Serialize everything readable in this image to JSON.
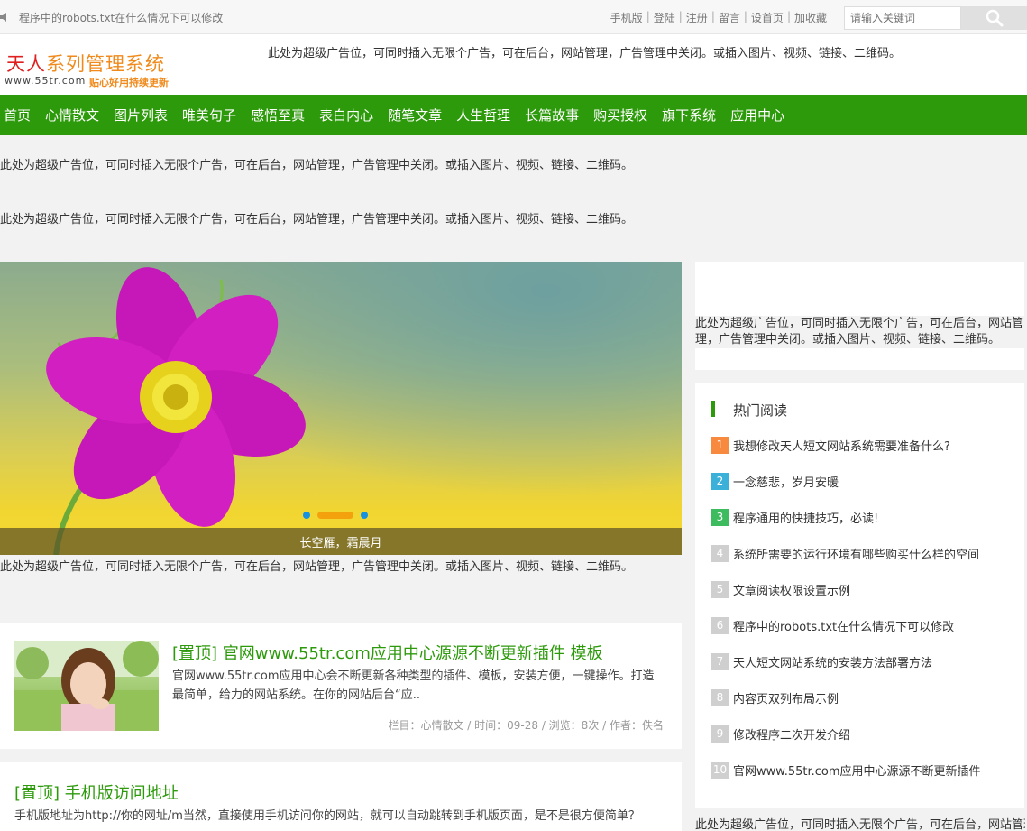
{
  "topbar": {
    "notice": "程序中的robots.txt在什么情况下可以修改",
    "links": [
      "手机版",
      "登陆",
      "注册",
      "留言",
      "设首页",
      "加收藏"
    ],
    "search_placeholder": "请输入关键词"
  },
  "header": {
    "logo_part1": "天人",
    "logo_part2": "系列管理系统",
    "logo_url": "www.55tr.com",
    "logo_tagline": "贴心好用持续更新",
    "ad": "此处为超级广告位，可同时插入无限个广告，可在后台，网站管理，广告管理中关闭。或插入图片、视频、链接、二维码。"
  },
  "nav": [
    "首页",
    "心情散文",
    "图片列表",
    "唯美句子",
    "感悟至真",
    "表白内心",
    "随笔文章",
    "人生哲理",
    "长篇故事",
    "购买授权",
    "旗下系统",
    "应用中心"
  ],
  "ads": {
    "ad1": "此处为超级广告位，可同时插入无限个广告，可在后台，网站管理，广告管理中关闭。或插入图片、视频、链接、二维码。",
    "ad2": "此处为超级广告位，可同时插入无限个广告，可在后台，网站管理，广告管理中关闭。或插入图片、视频、链接、二维码。",
    "ad3": "此处为超级广告位，可同时插入无限个广告，可在后台，网站管理，广告管理中关闭。或插入图片、视频、链接、二维码。"
  },
  "slider": {
    "caption": "长空雁，霜晨月"
  },
  "articles": [
    {
      "title": "[置顶] 官网www.55tr.com应用中心源源不断更新插件 模板",
      "desc": "官网www.55tr.com应用中心会不断更新各种类型的插件、模板，安装方便，一键操作。打造最简单，给力的网站系统。在你的网站后台“应..",
      "meta": "栏目：心情散文 / 时间：09-28 / 浏览：8次 / 作者：佚名"
    },
    {
      "title": "[置顶] 手机版访问地址",
      "desc": "手机版地址为http://你的网址/m当然，直接使用手机访问你的网站，就可以自动跳转到手机版页面，是不是很方便简单？"
    }
  ],
  "sidebar": {
    "ad": "此处为超级广告位，可同时插入无限个广告，可在后台，网站管理，广告管理中关闭。或插入图片、视频、链接、二维码。",
    "hot_title": "热门阅读",
    "hot_items": [
      {
        "num": "1",
        "text": "我想修改天人短文网站系统需要准备什么?"
      },
      {
        "num": "2",
        "text": "一念慈悲，岁月安暖"
      },
      {
        "num": "3",
        "text": "程序通用的快捷技巧，必读!"
      },
      {
        "num": "4",
        "text": "系统所需要的运行环境有哪些购买什么样的空间"
      },
      {
        "num": "5",
        "text": "文章阅读权限设置示例"
      },
      {
        "num": "6",
        "text": "程序中的robots.txt在什么情况下可以修改"
      },
      {
        "num": "7",
        "text": "天人短文网站系统的安装方法部署方法"
      },
      {
        "num": "8",
        "text": "内容页双列布局示例"
      },
      {
        "num": "9",
        "text": "修改程序二次开发介绍"
      },
      {
        "num": "10",
        "text": "官网www.55tr.com应用中心源源不断更新插件"
      }
    ],
    "hot_colors": [
      "#f78a3f",
      "#3bb0d8",
      "#3dbb5f"
    ],
    "bottom_ad": "此处为超级广告位，可同时插入无限个广告，可在后台，网站管理，广告管理中关闭。"
  },
  "colors": {
    "brand_green": "#2d9a0b",
    "accent_orange": "#f08a1c"
  }
}
